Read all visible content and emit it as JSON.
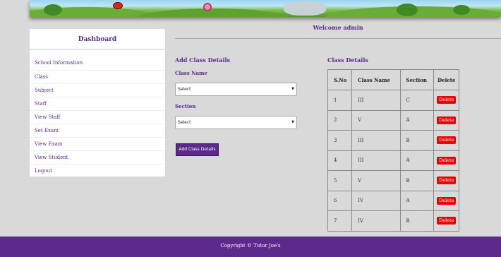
{
  "sidebar": {
    "title": "Dashboard",
    "items": [
      "School Information",
      "Class",
      "Subject",
      "Staff",
      "View Staff",
      "Set Exam",
      "View Exam",
      "View Student",
      "Logout"
    ]
  },
  "header": {
    "welcome": "Welcome admin"
  },
  "form": {
    "title": "Add Class Details",
    "class_label": "Class Name",
    "class_select": "Select",
    "section_label": "Section",
    "section_select": "Select",
    "submit_label": "Add Class Details"
  },
  "table": {
    "title": "Class Details",
    "headers": [
      "S.No",
      "Class Name",
      "Section",
      "Delete"
    ],
    "rows": [
      {
        "sno": "1",
        "class": "III",
        "section": "C",
        "action": "Delete"
      },
      {
        "sno": "2",
        "class": "V",
        "section": "A",
        "action": "Delete"
      },
      {
        "sno": "3",
        "class": "III",
        "section": "B",
        "action": "Delete"
      },
      {
        "sno": "4",
        "class": "III",
        "section": "A",
        "action": "Delete"
      },
      {
        "sno": "5",
        "class": "V",
        "section": "B",
        "action": "Delete"
      },
      {
        "sno": "6",
        "class": "IV",
        "section": "A",
        "action": "Delete"
      },
      {
        "sno": "7",
        "class": "IV",
        "section": "B",
        "action": "Delete"
      }
    ]
  },
  "footer": {
    "copyright": "Copyright © Tutor Joe's"
  },
  "colors": {
    "brand": "#5b2a8c",
    "danger": "#ee0000",
    "background": "#d9d9d9"
  }
}
